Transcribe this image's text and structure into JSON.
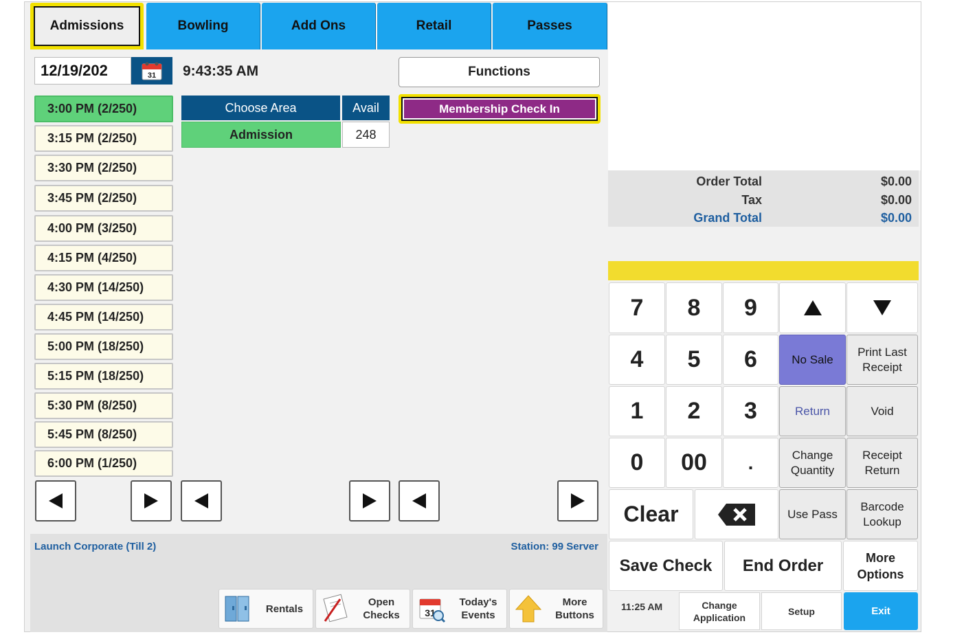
{
  "tabs": [
    {
      "label": "Admissions",
      "active": true
    },
    {
      "label": "Bowling"
    },
    {
      "label": "Add Ons"
    },
    {
      "label": "Retail"
    },
    {
      "label": "Passes"
    }
  ],
  "date": "12/19/202",
  "calendar_icon_day": "31",
  "clock": "9:43:35 AM",
  "time_slots": [
    "3:00 PM (2/250)",
    "3:15 PM (2/250)",
    "3:30 PM (2/250)",
    "3:45 PM (2/250)",
    "4:00 PM (3/250)",
    "4:15 PM (4/250)",
    "4:30 PM (14/250)",
    "4:45 PM (14/250)",
    "5:00 PM (18/250)",
    "5:15 PM (18/250)",
    "5:30 PM (8/250)",
    "5:45 PM (8/250)",
    "6:00 PM (1/250)"
  ],
  "area_table": {
    "header_area": "Choose Area",
    "header_avail": "Avail",
    "rows": [
      {
        "area": "Admission",
        "avail": "248"
      }
    ]
  },
  "functions_label": "Functions",
  "membership_label": "Membership Check In",
  "status": {
    "location": "Launch Corporate (Till 2)",
    "station": "Station: 99 Server"
  },
  "bottom_buttons": {
    "rentals": "Rentals",
    "open_checks_1": "Open",
    "open_checks_2": "Checks",
    "todays_events_1": "Today's",
    "todays_events_2": "Events",
    "more_buttons_1": "More",
    "more_buttons_2": "Buttons"
  },
  "totals": {
    "order_total_label": "Order Total",
    "order_total": "$0.00",
    "tax_label": "Tax",
    "tax": "$0.00",
    "grand_total_label": "Grand Total",
    "grand_total": "$0.00"
  },
  "keypad": {
    "k7": "7",
    "k8": "8",
    "k9": "9",
    "k4": "4",
    "k5": "5",
    "k6": "6",
    "k1": "1",
    "k2": "2",
    "k3": "3",
    "k0": "0",
    "k00": "00",
    "kdot": ".",
    "clear": "Clear",
    "no_sale": "No Sale",
    "print_last_1": "Print Last",
    "print_last_2": "Receipt",
    "return": "Return",
    "void": "Void",
    "change_qty_1": "Change",
    "change_qty_2": "Quantity",
    "receipt_return_1": "Receipt",
    "receipt_return_2": "Return",
    "use_pass": "Use Pass",
    "barcode_1": "Barcode",
    "barcode_2": "Lookup",
    "save_check": "Save Check",
    "end_order": "End Order",
    "more_options_1": "More",
    "more_options_2": "Options"
  },
  "footer": {
    "time": "11:25 AM",
    "change_app_1": "Change",
    "change_app_2": "Application",
    "setup": "Setup",
    "exit": "Exit"
  },
  "colors": {
    "tab_blue": "#1ba4ee",
    "header_navy": "#0a5386",
    "selected_green": "#5fd17a",
    "highlight_yellow": "#f2e100",
    "membership_purple": "#8e2a86",
    "no_sale_purple": "#7a7ad6",
    "exit_blue": "#1ba4ee"
  }
}
